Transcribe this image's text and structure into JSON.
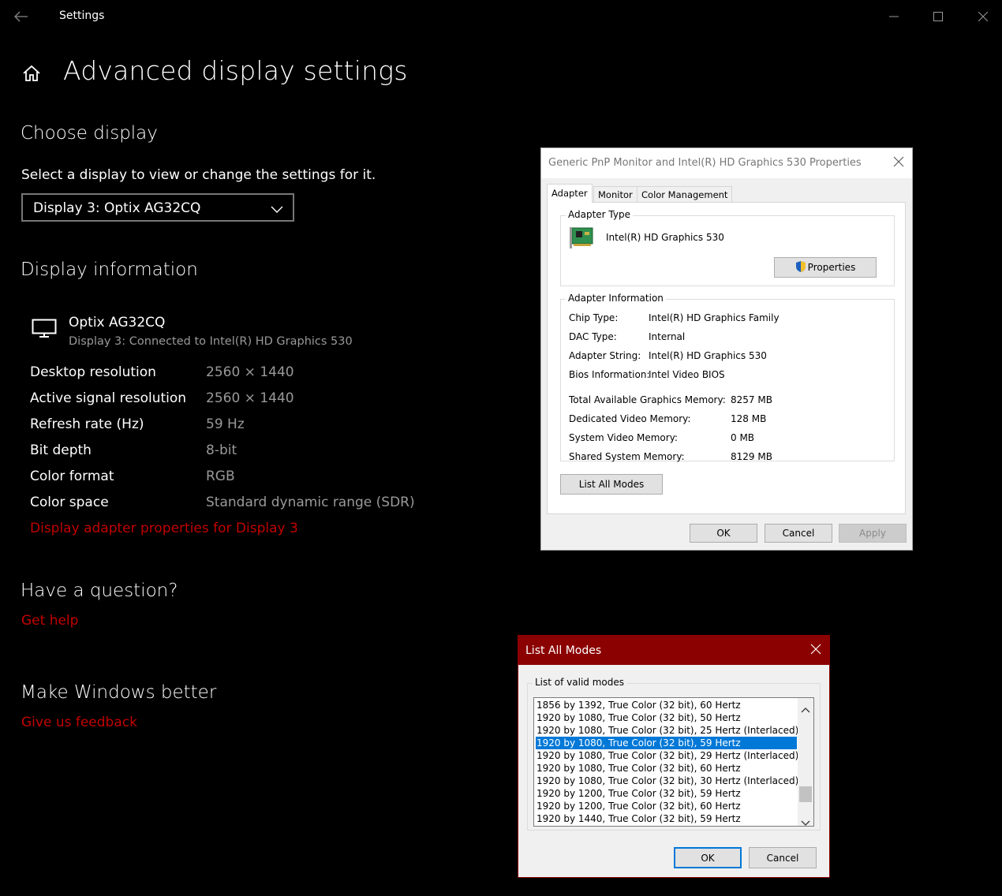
{
  "window": {
    "app_title": "Settings",
    "back_icon": "back-arrow-icon",
    "minimize_icon": "minimize-icon",
    "maximize_icon": "maximize-icon",
    "close_icon": "close-icon"
  },
  "page": {
    "home_icon": "home-icon",
    "title": "Advanced display settings"
  },
  "choose_display": {
    "heading": "Choose display",
    "description": "Select a display to view or change the settings for it.",
    "selected_display": "Display 3: Optix AG32CQ"
  },
  "display_information": {
    "heading": "Display information",
    "monitor_name": "Optix AG32CQ",
    "monitor_subtitle": "Display 3: Connected to Intel(R) HD Graphics 530",
    "rows": [
      {
        "label": "Desktop resolution",
        "value": "2560 × 1440"
      },
      {
        "label": "Active signal resolution",
        "value": "2560 × 1440"
      },
      {
        "label": "Refresh rate (Hz)",
        "value": "59 Hz"
      },
      {
        "label": "Bit depth",
        "value": "8-bit"
      },
      {
        "label": "Color format",
        "value": "RGB"
      },
      {
        "label": "Color space",
        "value": "Standard dynamic range (SDR)"
      }
    ],
    "adapter_link": "Display adapter properties for Display 3"
  },
  "question": {
    "heading": "Have a question?",
    "link": "Get help"
  },
  "feedback": {
    "heading": "Make Windows better",
    "link": "Give us feedback"
  },
  "properties_dialog": {
    "title": "Generic PnP Monitor and Intel(R) HD Graphics 530 Properties",
    "tabs": [
      "Adapter",
      "Monitor",
      "Color Management"
    ],
    "adapter_type_label": "Adapter Type",
    "adapter_type_value": "Intel(R) HD Graphics 530",
    "properties_button": "Properties",
    "adapter_info_label": "Adapter Information",
    "info": [
      {
        "label": "Chip Type:",
        "value": "Intel(R) HD Graphics Family"
      },
      {
        "label": "DAC Type:",
        "value": "Internal"
      },
      {
        "label": "Adapter String:",
        "value": "Intel(R) HD Graphics 530"
      },
      {
        "label": "Bios Information:",
        "value": "Intel Video BIOS"
      }
    ],
    "memory": [
      {
        "label": "Total Available Graphics Memory:",
        "value": "8257 MB"
      },
      {
        "label": "Dedicated Video Memory:",
        "value": "128 MB"
      },
      {
        "label": "System Video Memory:",
        "value": "0 MB"
      },
      {
        "label": "Shared System Memory:",
        "value": "8129 MB"
      }
    ],
    "list_all_modes_button": "List All Modes",
    "ok_button": "OK",
    "cancel_button": "Cancel",
    "apply_button": "Apply"
  },
  "modes_dialog": {
    "title": "List All Modes",
    "group_label": "List of valid modes",
    "modes": [
      "1856 by 1392, True Color (32 bit), 60 Hertz",
      "1920 by 1080, True Color (32 bit), 50 Hertz",
      "1920 by 1080, True Color (32 bit), 25 Hertz (Interlaced)",
      "1920 by 1080, True Color (32 bit), 59 Hertz",
      "1920 by 1080, True Color (32 bit), 29 Hertz (Interlaced)",
      "1920 by 1080, True Color (32 bit), 60 Hertz",
      "1920 by 1080, True Color (32 bit), 30 Hertz (Interlaced)",
      "1920 by 1200, True Color (32 bit), 59 Hertz",
      "1920 by 1200, True Color (32 bit), 60 Hertz",
      "1920 by 1440, True Color (32 bit), 59 Hertz"
    ],
    "selected_index": 3,
    "ok_button": "OK",
    "cancel_button": "Cancel"
  },
  "colors": {
    "link_red": "#c30000",
    "selection_blue": "#0078d7",
    "titlebar_red": "#8b0000"
  }
}
